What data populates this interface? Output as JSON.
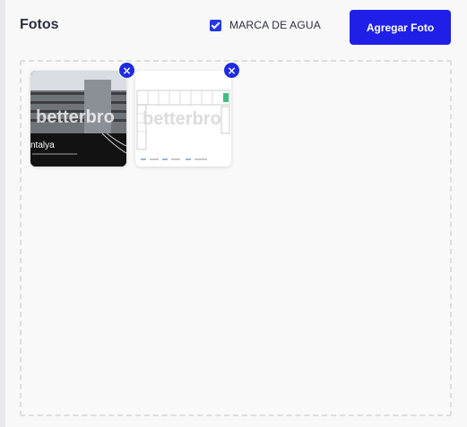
{
  "panel": {
    "title": "Fotos",
    "watermark": {
      "label": "MARCA DE AGUA",
      "checked": true
    },
    "add_button_label": "Agregar Foto"
  },
  "photos": [
    {
      "overlay_text": "betterbro",
      "caption": "ntalya",
      "remove_glyph": "×"
    },
    {
      "overlay_text": "betterbro",
      "remove_glyph": "×"
    }
  ],
  "colors": {
    "accent": "#1f1fe8",
    "text": "#2b3040",
    "dropzone_border": "#dedede"
  }
}
